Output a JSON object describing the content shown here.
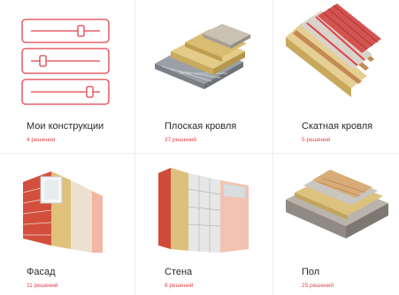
{
  "cards": [
    {
      "title": "Мои конструкции",
      "count": "4 решения",
      "icon": "sliders-icon"
    },
    {
      "title": "Плоская кровля",
      "count": "37 решений",
      "icon": "flat-roof-icon"
    },
    {
      "title": "Скатная кровля",
      "count": "5 решений",
      "icon": "pitched-roof-icon"
    },
    {
      "title": "Фасад",
      "count": "11 решений",
      "icon": "facade-icon"
    },
    {
      "title": "Стена",
      "count": "8 решений",
      "icon": "wall-icon"
    },
    {
      "title": "Пол",
      "count": "25 решений",
      "icon": "floor-icon"
    }
  ],
  "colors": {
    "accent": "#e2424b",
    "text": "#2b2b2b"
  }
}
